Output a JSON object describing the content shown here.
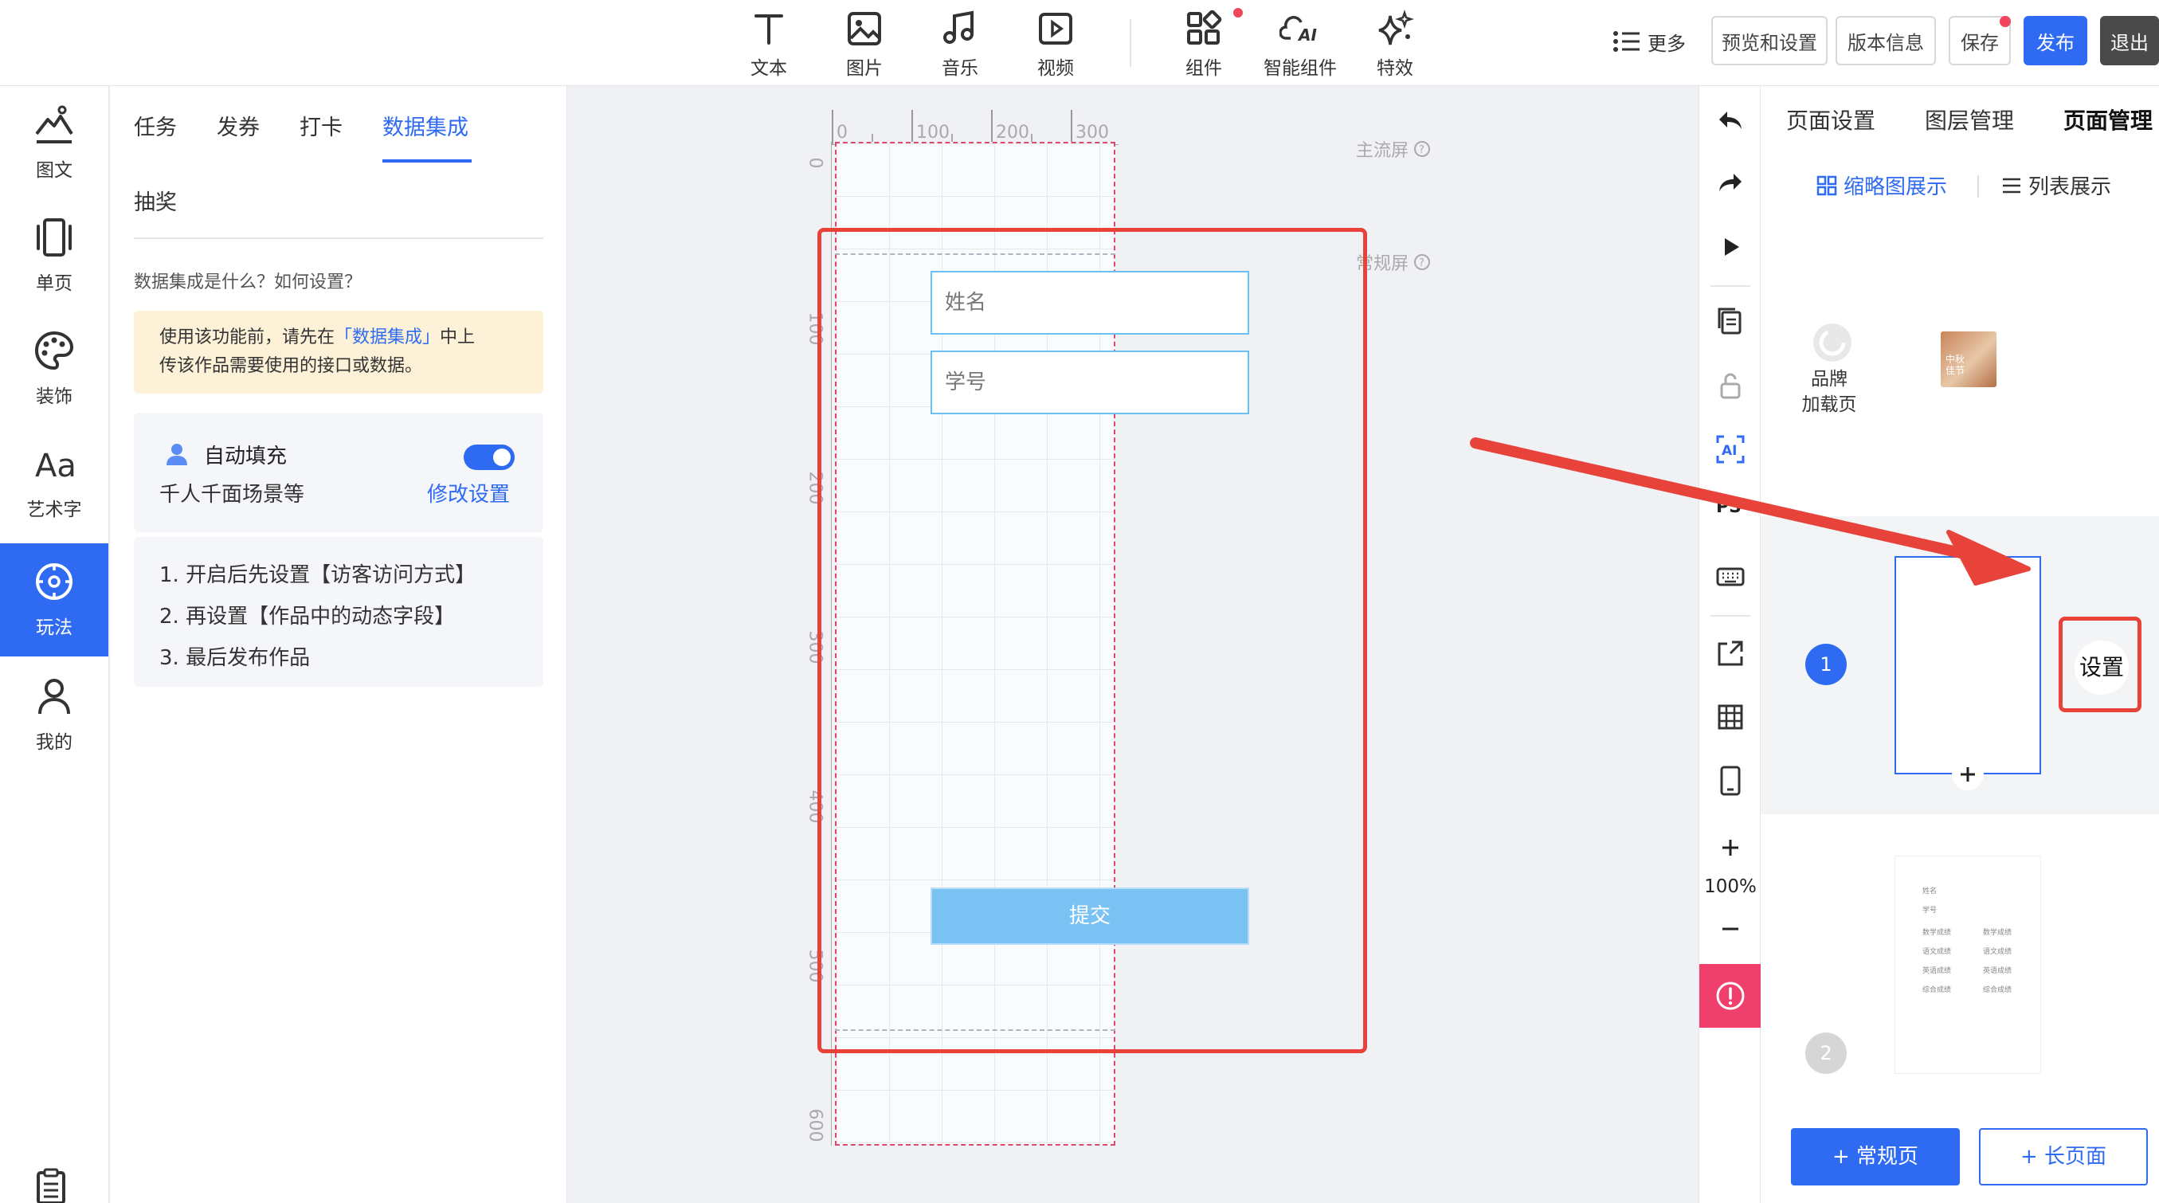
{
  "toolbar": {
    "tools": [
      {
        "label": "文本",
        "icon": "text-icon"
      },
      {
        "label": "图片",
        "icon": "image-icon"
      },
      {
        "label": "音乐",
        "icon": "music-icon"
      },
      {
        "label": "视频",
        "icon": "video-icon"
      },
      {
        "label": "组件",
        "icon": "component-icon"
      },
      {
        "label": "智能组件",
        "icon": "ai-component-icon"
      },
      {
        "label": "特效",
        "icon": "sparkle-icon"
      }
    ],
    "more_label": "更多",
    "preview_label": "预览和设置",
    "version_label": "版本信息",
    "save_label": "保存",
    "publish_label": "发布",
    "exit_label": "退出"
  },
  "leftnav": {
    "items": [
      {
        "label": "图文",
        "icon": "mountain-text-icon"
      },
      {
        "label": "单页",
        "icon": "single-page-icon"
      },
      {
        "label": "装饰",
        "icon": "palette-icon"
      },
      {
        "label": "艺术字",
        "icon": "art-text-icon"
      },
      {
        "label": "玩法",
        "icon": "compass-icon",
        "active": true
      },
      {
        "label": "我的",
        "icon": "user-icon"
      }
    ]
  },
  "leftpanel": {
    "tabs": [
      "任务",
      "发券",
      "打卡",
      "数据集成"
    ],
    "active_tab": "数据集成",
    "sub_tab": "抽奖",
    "help_text": "数据集成是什么？如何设置？",
    "notice": {
      "prefix": "使用该功能前，请先在",
      "link": "「数据集成」",
      "suffix": "中上",
      "line2": "传该作品需要使用的接口或数据。"
    },
    "autofill": {
      "title": "自动填充",
      "subtitle": "千人千面场景等",
      "link": "修改设置",
      "enabled": true
    },
    "steps": [
      "1. 开启后先设置【访客访问方式】",
      "2. 再设置【作品中的动态字段】",
      "3. 最后发布作品"
    ]
  },
  "canvas": {
    "ruler_top": [
      "0",
      "100",
      "200",
      "300"
    ],
    "ruler_left": [
      "0",
      "100",
      "200",
      "300",
      "400",
      "500",
      "600"
    ],
    "main_screen_label": "主流屏",
    "normal_screen_label": "常规屏",
    "field1_placeholder": "姓名",
    "field2_placeholder": "学号",
    "submit_label": "提交"
  },
  "rstrip": {
    "zoom": "100%"
  },
  "rightpanel": {
    "tabs": [
      "页面设置",
      "图层管理",
      "页面管理"
    ],
    "active_tab": "页面管理",
    "view_thumb": "缩略图展示",
    "view_list": "列表展示",
    "brand_page": {
      "line1": "品牌",
      "line2": "加载页"
    },
    "thumb_brand_text": "中秋佳节",
    "page1": {
      "num": "1",
      "settings": "设置"
    },
    "page2": {
      "num": "2",
      "thumb_lines": [
        "姓名",
        "学号",
        "数学成绩",
        "数学成绩",
        "语文成绩",
        "语文成绩",
        "英语成绩",
        "英语成绩",
        "综合成绩",
        "综合成绩"
      ]
    },
    "add_normal": "+ 常规页",
    "add_long": "+ 长页面"
  },
  "colors": {
    "accent": "#2f6bf2",
    "annotation_red": "#e8433a",
    "submit_bg": "#7ac1f4",
    "alert_pink": "#ef3f6d"
  }
}
